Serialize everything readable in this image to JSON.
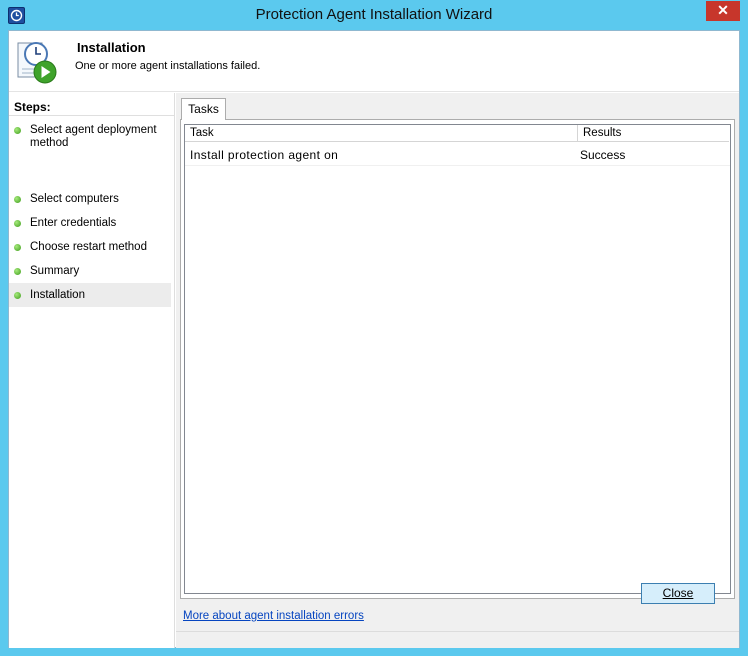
{
  "window": {
    "title": "Protection Agent Installation Wizard",
    "close_glyph": "✕"
  },
  "header": {
    "title": "Installation",
    "subtitle": "One or more agent installations failed."
  },
  "sidebar": {
    "label": "Steps:",
    "steps": [
      {
        "label": "Select agent deployment method"
      },
      {
        "label": "Select computers"
      },
      {
        "label": "Enter credentials"
      },
      {
        "label": "Choose restart method"
      },
      {
        "label": "Summary"
      },
      {
        "label": "Installation"
      }
    ]
  },
  "main": {
    "tab_label": "Tasks",
    "columns": [
      "Task",
      "Results"
    ],
    "rows": [
      {
        "task": "Install protection agent on",
        "result": "Success"
      }
    ],
    "help_link": "More about agent installation errors"
  },
  "footer": {
    "close_label": "Close"
  },
  "colors": {
    "titlebar": "#5bc9ee",
    "close_button": "#c7362b",
    "step_dot": "#3e9c1c",
    "link": "#0645c0"
  },
  "icons": {
    "app": "clock-icon",
    "header": "clock-play-icon",
    "step": "green-dot-icon"
  }
}
